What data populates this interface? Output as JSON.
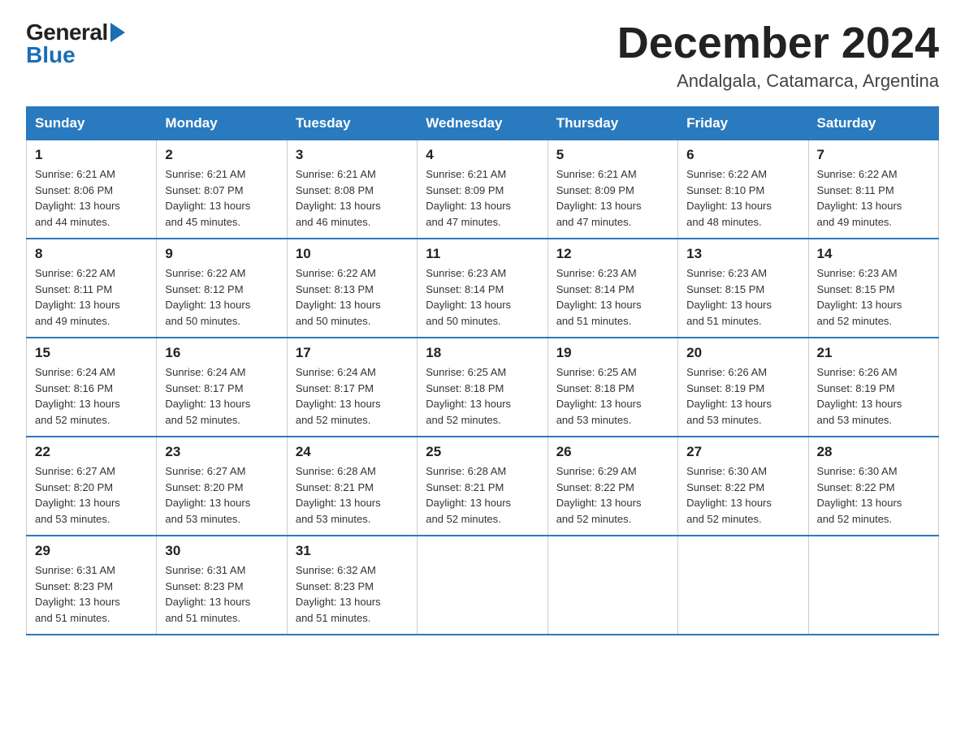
{
  "header": {
    "title": "December 2024",
    "subtitle": "Andalgala, Catamarca, Argentina",
    "logo_general": "General",
    "logo_blue": "Blue"
  },
  "calendar": {
    "days_of_week": [
      "Sunday",
      "Monday",
      "Tuesday",
      "Wednesday",
      "Thursday",
      "Friday",
      "Saturday"
    ],
    "weeks": [
      [
        {
          "day": "1",
          "sunrise": "6:21 AM",
          "sunset": "8:06 PM",
          "daylight": "13 hours and 44 minutes."
        },
        {
          "day": "2",
          "sunrise": "6:21 AM",
          "sunset": "8:07 PM",
          "daylight": "13 hours and 45 minutes."
        },
        {
          "day": "3",
          "sunrise": "6:21 AM",
          "sunset": "8:08 PM",
          "daylight": "13 hours and 46 minutes."
        },
        {
          "day": "4",
          "sunrise": "6:21 AM",
          "sunset": "8:09 PM",
          "daylight": "13 hours and 47 minutes."
        },
        {
          "day": "5",
          "sunrise": "6:21 AM",
          "sunset": "8:09 PM",
          "daylight": "13 hours and 47 minutes."
        },
        {
          "day": "6",
          "sunrise": "6:22 AM",
          "sunset": "8:10 PM",
          "daylight": "13 hours and 48 minutes."
        },
        {
          "day": "7",
          "sunrise": "6:22 AM",
          "sunset": "8:11 PM",
          "daylight": "13 hours and 49 minutes."
        }
      ],
      [
        {
          "day": "8",
          "sunrise": "6:22 AM",
          "sunset": "8:11 PM",
          "daylight": "13 hours and 49 minutes."
        },
        {
          "day": "9",
          "sunrise": "6:22 AM",
          "sunset": "8:12 PM",
          "daylight": "13 hours and 50 minutes."
        },
        {
          "day": "10",
          "sunrise": "6:22 AM",
          "sunset": "8:13 PM",
          "daylight": "13 hours and 50 minutes."
        },
        {
          "day": "11",
          "sunrise": "6:23 AM",
          "sunset": "8:14 PM",
          "daylight": "13 hours and 50 minutes."
        },
        {
          "day": "12",
          "sunrise": "6:23 AM",
          "sunset": "8:14 PM",
          "daylight": "13 hours and 51 minutes."
        },
        {
          "day": "13",
          "sunrise": "6:23 AM",
          "sunset": "8:15 PM",
          "daylight": "13 hours and 51 minutes."
        },
        {
          "day": "14",
          "sunrise": "6:23 AM",
          "sunset": "8:15 PM",
          "daylight": "13 hours and 52 minutes."
        }
      ],
      [
        {
          "day": "15",
          "sunrise": "6:24 AM",
          "sunset": "8:16 PM",
          "daylight": "13 hours and 52 minutes."
        },
        {
          "day": "16",
          "sunrise": "6:24 AM",
          "sunset": "8:17 PM",
          "daylight": "13 hours and 52 minutes."
        },
        {
          "day": "17",
          "sunrise": "6:24 AM",
          "sunset": "8:17 PM",
          "daylight": "13 hours and 52 minutes."
        },
        {
          "day": "18",
          "sunrise": "6:25 AM",
          "sunset": "8:18 PM",
          "daylight": "13 hours and 52 minutes."
        },
        {
          "day": "19",
          "sunrise": "6:25 AM",
          "sunset": "8:18 PM",
          "daylight": "13 hours and 53 minutes."
        },
        {
          "day": "20",
          "sunrise": "6:26 AM",
          "sunset": "8:19 PM",
          "daylight": "13 hours and 53 minutes."
        },
        {
          "day": "21",
          "sunrise": "6:26 AM",
          "sunset": "8:19 PM",
          "daylight": "13 hours and 53 minutes."
        }
      ],
      [
        {
          "day": "22",
          "sunrise": "6:27 AM",
          "sunset": "8:20 PM",
          "daylight": "13 hours and 53 minutes."
        },
        {
          "day": "23",
          "sunrise": "6:27 AM",
          "sunset": "8:20 PM",
          "daylight": "13 hours and 53 minutes."
        },
        {
          "day": "24",
          "sunrise": "6:28 AM",
          "sunset": "8:21 PM",
          "daylight": "13 hours and 53 minutes."
        },
        {
          "day": "25",
          "sunrise": "6:28 AM",
          "sunset": "8:21 PM",
          "daylight": "13 hours and 52 minutes."
        },
        {
          "day": "26",
          "sunrise": "6:29 AM",
          "sunset": "8:22 PM",
          "daylight": "13 hours and 52 minutes."
        },
        {
          "day": "27",
          "sunrise": "6:30 AM",
          "sunset": "8:22 PM",
          "daylight": "13 hours and 52 minutes."
        },
        {
          "day": "28",
          "sunrise": "6:30 AM",
          "sunset": "8:22 PM",
          "daylight": "13 hours and 52 minutes."
        }
      ],
      [
        {
          "day": "29",
          "sunrise": "6:31 AM",
          "sunset": "8:23 PM",
          "daylight": "13 hours and 51 minutes."
        },
        {
          "day": "30",
          "sunrise": "6:31 AM",
          "sunset": "8:23 PM",
          "daylight": "13 hours and 51 minutes."
        },
        {
          "day": "31",
          "sunrise": "6:32 AM",
          "sunset": "8:23 PM",
          "daylight": "13 hours and 51 minutes."
        },
        null,
        null,
        null,
        null
      ]
    ],
    "labels": {
      "sunrise": "Sunrise:",
      "sunset": "Sunset:",
      "daylight": "Daylight:"
    }
  }
}
